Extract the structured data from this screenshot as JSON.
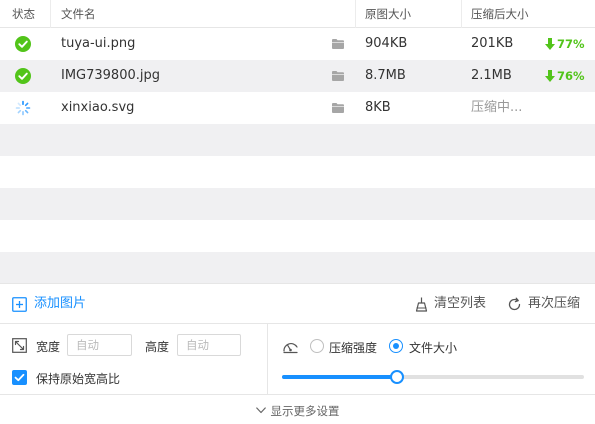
{
  "table": {
    "headers": {
      "status": "状态",
      "filename": "文件名",
      "original_size": "原图大小",
      "compressed_size": "压缩后大小"
    },
    "rows": [
      {
        "status": "done",
        "status_icon": "check-circle-icon",
        "filename": "tuya-ui.png",
        "original_size": "904KB",
        "compressed_size": "201KB",
        "ratio": "77%"
      },
      {
        "status": "done",
        "status_icon": "check-circle-icon",
        "filename": "IMG739800.jpg",
        "original_size": "8.7MB",
        "compressed_size": "2.1MB",
        "ratio": "76%"
      },
      {
        "status": "compressing",
        "status_icon": "spinner-icon",
        "filename": "xinxiao.svg",
        "original_size": "8KB",
        "compressed_size": "压缩中..."
      }
    ]
  },
  "toolbar": {
    "add_image": "添加图片",
    "clear_list": "清空列表",
    "recompress": "再次压缩"
  },
  "dimensions": {
    "width_label": "宽度",
    "width_placeholder": "自动",
    "height_label": "高度",
    "height_placeholder": "自动",
    "keep_ratio_label": "保持原始宽高比",
    "keep_ratio_checked": true
  },
  "compression": {
    "mode_quality_label": "压缩强度",
    "mode_filesize_label": "文件大小",
    "selected_mode": "filesize",
    "slider_fraction": 0.38
  },
  "footer": {
    "more_settings": "显示更多设置"
  },
  "colors": {
    "accent": "#1890ff",
    "success": "#52c41a",
    "alt_row": "#f0f0f2"
  }
}
